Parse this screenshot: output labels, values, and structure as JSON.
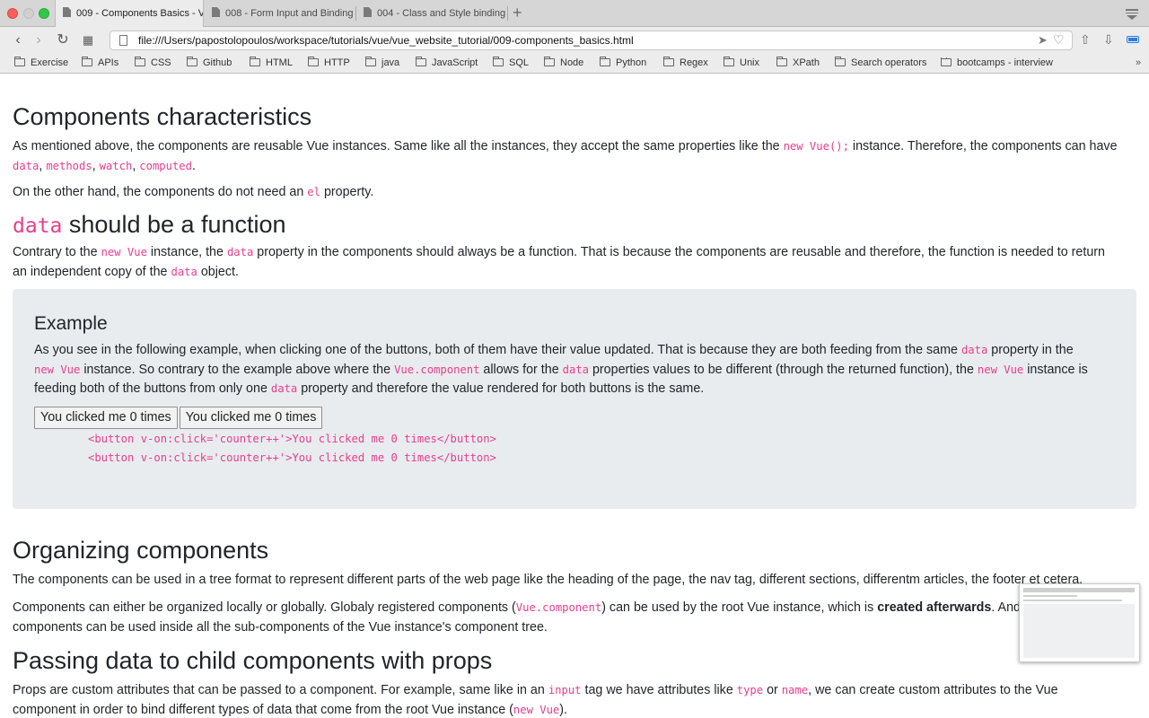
{
  "browser": {
    "tabs": [
      {
        "title": "009 - Components Basics - V",
        "active": true
      },
      {
        "title": "008 - Form Input and Binding",
        "active": false
      },
      {
        "title": "004 - Class and Style binding",
        "active": false
      }
    ],
    "new_tab": "+",
    "url": "file:///Users/papostolopoulos/workspace/tutorials/vue/vue_website_tutorial/009-components_basics.html",
    "bookmarks": [
      "Exercise",
      "APIs",
      "CSS",
      "Github",
      "HTML",
      "HTTP",
      "java",
      "JavaScript",
      "SQL",
      "Node",
      "Python",
      "Regex",
      "Unix",
      "XPath",
      "Search operators",
      "bootcamps - interview"
    ],
    "bookmarks_more": "»"
  },
  "content": {
    "s1_title": "Components characteristics",
    "s1_p1_a": "As mentioned above, the components are reusable Vue instances. Same like all the instances, they accept the same properties like the ",
    "s1_p1_code": "new Vue();",
    "s1_p1_b": " instance. Therefore, the components can have",
    "s1_p1_c1": "data",
    "s1_p1_sep1": ", ",
    "s1_p1_c2": "methods",
    "s1_p1_sep2": ", ",
    "s1_p1_c3": "watch",
    "s1_p1_sep3": ", ",
    "s1_p1_c4": "computed",
    "s1_p1_end": ".",
    "s1_p2_a": "On the other hand, the components do not need an ",
    "s1_p2_code": "el",
    "s1_p2_b": " property.",
    "s2_title_code": "data",
    "s2_title_text": " should be a function",
    "s2_p_a": "Contrary to the ",
    "s2_p_c1": "new Vue",
    "s2_p_b": " instance, the ",
    "s2_p_c2": "data",
    "s2_p_c": " property in the components should always be a function. That is because the components are reusable and therefore, the function is needed to return",
    "s2_p_d": "an independent copy of the ",
    "s2_p_c3": "data",
    "s2_p_e": " object.",
    "example": {
      "title": "Example",
      "p_a": "As you see in the following example, when clicking one of the buttons, both of them have their value updated. That is because they are both feeding from the same ",
      "p_c1": "data",
      "p_b": " property in the",
      "p_c2": "new Vue",
      "p_c": " instance. So contrary to the example above where the ",
      "p_c3": "Vue.component",
      "p_d": " allows for the ",
      "p_c4": "data",
      "p_e": " properties values to be different (through the returned function), the ",
      "p_c5": "new Vue",
      "p_f": " instance is",
      "p_g": "feeding both of the buttons from only one ",
      "p_c6": "data",
      "p_h": " property and therefore the value rendered for both buttons is the same.",
      "button1": "You clicked me 0 times",
      "button2": "You clicked me 0 times",
      "code_line1": "<button v-on:click='counter++'>You clicked me 0 times</button>",
      "code_line2": "<button v-on:click='counter++'>You clicked me 0 times</button>"
    },
    "s3_title": "Organizing components",
    "s3_p1": "The components can be used in a tree format to represent different parts of the web page like the heading of the page, the nav tag, different sections, differentm articles, the footer et cetera.",
    "s3_p2_a": "Components can either be organized locally or globally. Globaly registered components (",
    "s3_p2_code": "Vue.component",
    "s3_p2_b": ") can be used by the root Vue instance, which is ",
    "s3_p2_bold": "created afterwards",
    "s3_p2_c": ". And the",
    "s3_p2_d": "components can be used inside all the sub-components of the Vue instance's component tree.",
    "s4_title": "Passing data to child components with props",
    "s4_p_a": "Props are custom attributes that can be passed to a component. For example, same like in an ",
    "s4_p_c1": "input",
    "s4_p_b": " tag we have attributes like ",
    "s4_p_c2": "type",
    "s4_p_c": " or ",
    "s4_p_c3": "name",
    "s4_p_d": ", we can create custom attributes to the Vue",
    "s4_p_e": "component in order to bind different types of data that come from the root Vue instance (",
    "s4_p_c4": "new Vue",
    "s4_p_f": ")."
  }
}
